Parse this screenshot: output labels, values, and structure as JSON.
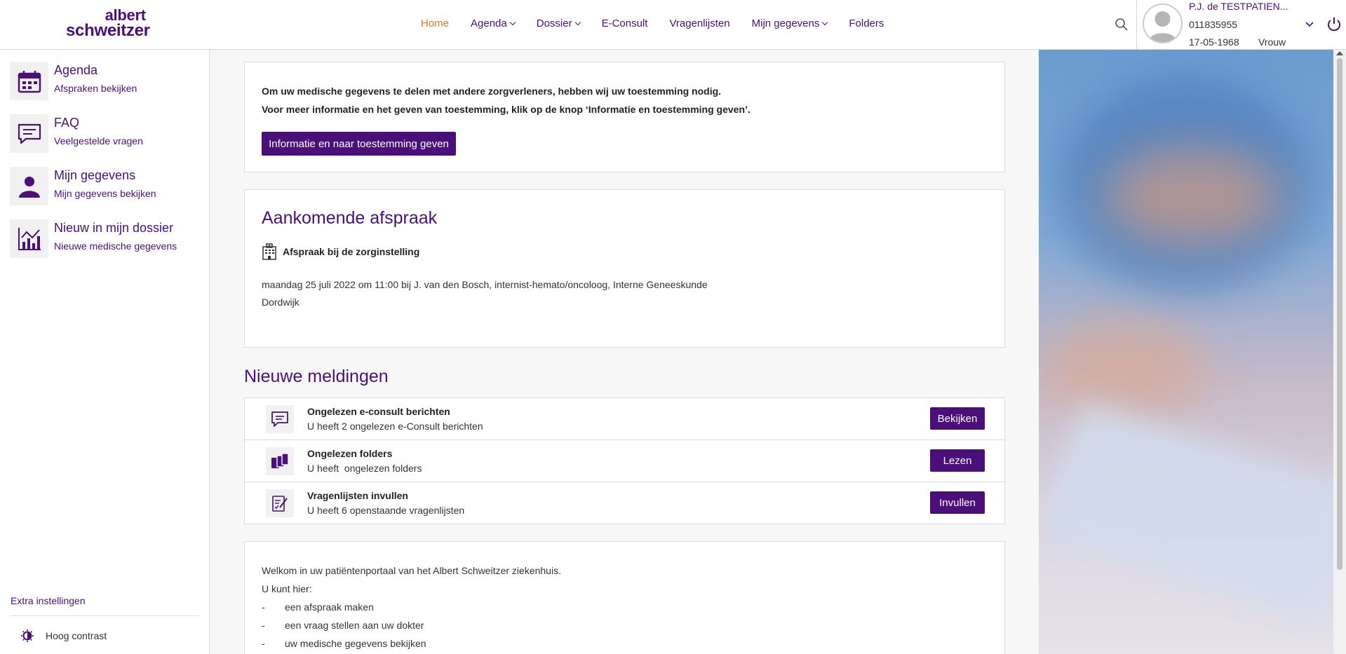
{
  "header": {
    "logo_line1": "albert",
    "logo_line2": "schweitzer",
    "nav": [
      {
        "label": "Home",
        "active": true,
        "dropdown": false
      },
      {
        "label": "Agenda",
        "dropdown": true
      },
      {
        "label": "Dossier",
        "dropdown": true
      },
      {
        "label": "E-Consult",
        "dropdown": false
      },
      {
        "label": "Vragenlijsten",
        "dropdown": false
      },
      {
        "label": "Mijn gegevens",
        "dropdown": true
      },
      {
        "label": "Folders",
        "dropdown": false
      }
    ],
    "user": {
      "name": "P.J. de TESTPATIEN...",
      "id": "011835955",
      "dob": "17-05-1968",
      "gender": "Vrouw"
    },
    "colors": {
      "brand": "#4b0f7a",
      "active": "#e07b1c"
    }
  },
  "sidebar": {
    "items": [
      {
        "title": "Agenda",
        "subtitle": "Afspraken bekijken",
        "icon": "calendar-icon"
      },
      {
        "title": "FAQ",
        "subtitle": "Veelgestelde vragen",
        "icon": "chat-icon"
      },
      {
        "title": "Mijn gegevens",
        "subtitle": "Mijn gegevens bekijken",
        "icon": "person-icon"
      },
      {
        "title": "Nieuw in mijn dossier",
        "subtitle": "Nieuwe medische gegevens",
        "icon": "chart-icon"
      }
    ],
    "extra": "Extra instellingen",
    "contrast": "Hoog contrast"
  },
  "consent": {
    "line1": "Om uw medische gegevens te delen met andere zorgverleners, hebben wij uw toestemming nodig.",
    "line2": "Voor meer informatie en het geven van toestemming, klik op de knop ‘Informatie en toestemming geven’.",
    "button": "Informatie en naar toestemming geven"
  },
  "appointment": {
    "title": "Aankomende afspraak",
    "subtitle": "Afspraak bij de zorginstelling",
    "line1": "maandag 25 juli 2022 om 11:00 bij J. van den Bosch, internist-hemato/oncoloog, Interne Geneeskunde",
    "line2": "Dordwijk"
  },
  "notifications": {
    "title": "Nieuwe meldingen",
    "items": [
      {
        "title": "Ongelezen e-consult berichten",
        "subtitle": "U heeft 2 ongelezen e-Consult berichten",
        "button": "Bekijken",
        "icon": "message-icon"
      },
      {
        "title": "Ongelezen folders",
        "subtitle": "U heeft  ongelezen folders",
        "button": "Lezen",
        "icon": "folders-icon"
      },
      {
        "title": "Vragenlijsten invullen",
        "subtitle": "U heeft 6 openstaande vragenlijsten",
        "button": "Invullen",
        "icon": "questionnaire-icon"
      }
    ]
  },
  "welcome": {
    "line1": "Welkom in uw patiëntenportaal van het Albert Schweitzer ziekenhuis.",
    "line2": "U kunt hier:",
    "bullets": [
      "een afspraak maken",
      "een vraag stellen aan uw dokter",
      "uw medische gegevens bekijken"
    ],
    "dash": "-"
  }
}
